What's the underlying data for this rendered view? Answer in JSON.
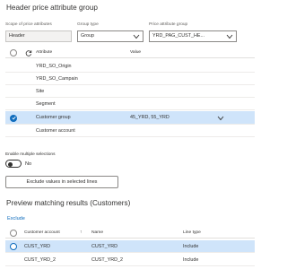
{
  "header": {
    "title": "Header price attribute group"
  },
  "fields": {
    "scope": {
      "label": "Scope of price attributes",
      "value": "Header"
    },
    "group_type": {
      "label": "Group type",
      "value": "Group"
    },
    "price_group": {
      "label": "Price attribute group",
      "value": "YRD_PAG_CUST_HE..."
    }
  },
  "attribute_grid": {
    "columns": {
      "attribute": "Attribute",
      "value": "Value"
    },
    "rows": [
      {
        "attribute": "YRD_SO_Origin",
        "value": ""
      },
      {
        "attribute": "YRD_SO_Campain",
        "value": ""
      },
      {
        "attribute": "Site",
        "value": ""
      },
      {
        "attribute": "Segment",
        "value": ""
      },
      {
        "attribute": "Customer group",
        "value": "45_YRD, 55_YRD",
        "selected": true
      },
      {
        "attribute": "Customer account",
        "value": ""
      }
    ]
  },
  "multi_select": {
    "label": "Enable multiple selections",
    "value": "No"
  },
  "exclude_button": {
    "label": "Exclude values in selected lines"
  },
  "preview": {
    "title": "Preview matching results (Customers)",
    "action_label": "Exclude",
    "columns": {
      "account": "Customer account",
      "name": "Name",
      "line_type": "Line type"
    },
    "sort_indicator": "↑",
    "rows": [
      {
        "account": "CUST_YRD",
        "name": "CUST_YRD",
        "line_type": "Include",
        "selected": true
      },
      {
        "account": "CUST_YRD_2",
        "name": "CUST_YRD_2",
        "line_type": "Include"
      }
    ]
  },
  "colors": {
    "accent": "#0f6cbd",
    "selected_row": "#cfe4fa"
  },
  "icons": [
    "refresh-icon",
    "chevron-down-icon",
    "checkmark-icon",
    "sort-up-icon"
  ]
}
